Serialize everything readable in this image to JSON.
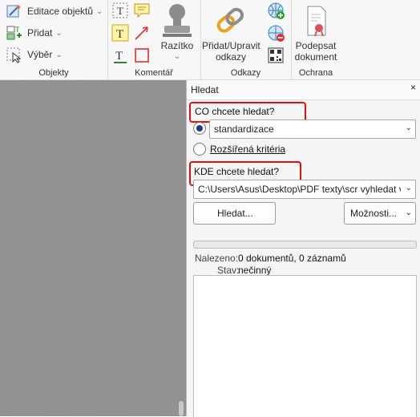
{
  "ribbon": {
    "objekty": {
      "items": [
        {
          "label": "Editace objektů",
          "icon": "edit-objects-icon"
        },
        {
          "label": "Přidat",
          "icon": "add-object-icon"
        },
        {
          "label": "Výběr",
          "icon": "select-icon"
        }
      ],
      "group_label": "Objekty"
    },
    "komentar": {
      "stamp_label": "Razítko",
      "group_label": "Komentář"
    },
    "odkazy": {
      "link_label": "Přidat/Upravit odkazy",
      "group_label": "Odkazy"
    },
    "ochrana": {
      "sign_label": "Podepsat dokument",
      "group_label": "Ochrana"
    }
  },
  "search_panel": {
    "title": "Hledat",
    "close": "×",
    "what_label": "CO chcete hledat?",
    "what_value": "standardizace",
    "advanced_label": "Rozšířená kritéria",
    "where_label": "KDE chcete hledat?",
    "where_value": "C:\\Users\\Asus\\Desktop\\PDF texty\\scr vyhledat v",
    "search_button": "Hledat...",
    "options_button": "Možnosti...",
    "found_label": "Nalezeno:",
    "found_value": "0 dokumentů, 0 záznamů",
    "status_label": "Stav:",
    "status_value": "nečinný"
  },
  "colors": {
    "highlight": "#e01010",
    "radio_selected": "#1a3c8c",
    "canvas_bg": "#8f8f8f"
  }
}
